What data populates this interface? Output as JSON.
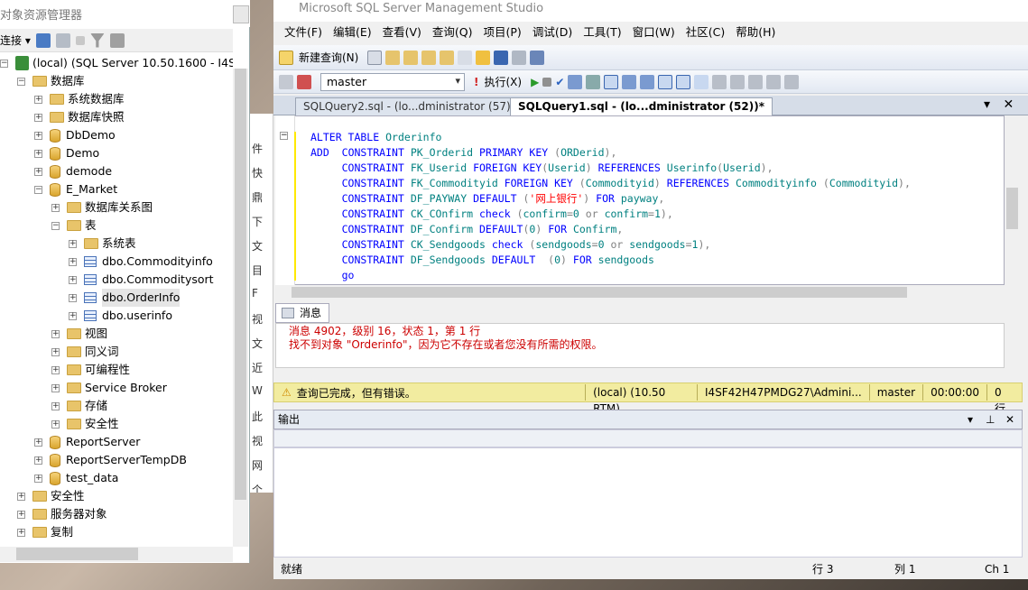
{
  "object_explorer": {
    "title": "对象资源管理器",
    "connect_label": "连接",
    "tree": [
      {
        "label": "(local) (SQL Server 10.50.1600 - I4SF42",
        "level": 0,
        "icon": "server",
        "expand": "-"
      },
      {
        "label": "数据库",
        "level": 1,
        "icon": "folder",
        "expand": "-"
      },
      {
        "label": "系统数据库",
        "level": 2,
        "icon": "folder",
        "expand": "+"
      },
      {
        "label": "数据库快照",
        "level": 2,
        "icon": "folder",
        "expand": "+"
      },
      {
        "label": "DbDemo",
        "level": 2,
        "icon": "database",
        "expand": "+"
      },
      {
        "label": "Demo",
        "level": 2,
        "icon": "database",
        "expand": "+"
      },
      {
        "label": "demode",
        "level": 2,
        "icon": "database",
        "expand": "+"
      },
      {
        "label": "E_Market",
        "level": 2,
        "icon": "database",
        "expand": "-"
      },
      {
        "label": "数据库关系图",
        "level": 3,
        "icon": "folder",
        "expand": "+"
      },
      {
        "label": "表",
        "level": 3,
        "icon": "folder",
        "expand": "-"
      },
      {
        "label": "系统表",
        "level": 4,
        "icon": "folder",
        "expand": "+"
      },
      {
        "label": "dbo.Commodityinfo",
        "level": 4,
        "icon": "table",
        "expand": "+"
      },
      {
        "label": "dbo.Commoditysort",
        "level": 4,
        "icon": "table",
        "expand": "+"
      },
      {
        "label": "dbo.OrderInfo",
        "level": 4,
        "icon": "table",
        "expand": "+",
        "selected": true
      },
      {
        "label": "dbo.userinfo",
        "level": 4,
        "icon": "table",
        "expand": "+"
      },
      {
        "label": "视图",
        "level": 3,
        "icon": "folder",
        "expand": "+"
      },
      {
        "label": "同义词",
        "level": 3,
        "icon": "folder",
        "expand": "+"
      },
      {
        "label": "可编程性",
        "level": 3,
        "icon": "folder",
        "expand": "+"
      },
      {
        "label": "Service Broker",
        "level": 3,
        "icon": "folder",
        "expand": "+"
      },
      {
        "label": "存储",
        "level": 3,
        "icon": "folder",
        "expand": "+"
      },
      {
        "label": "安全性",
        "level": 3,
        "icon": "folder",
        "expand": "+"
      },
      {
        "label": "ReportServer",
        "level": 2,
        "icon": "database",
        "expand": "+"
      },
      {
        "label": "ReportServerTempDB",
        "level": 2,
        "icon": "database",
        "expand": "+"
      },
      {
        "label": "test_data",
        "level": 2,
        "icon": "database",
        "expand": "+"
      },
      {
        "label": "安全性",
        "level": 1,
        "icon": "folder",
        "expand": "+"
      },
      {
        "label": "服务器对象",
        "level": 1,
        "icon": "folder",
        "expand": "+"
      },
      {
        "label": "复制",
        "level": 1,
        "icon": "folder",
        "expand": "+"
      }
    ]
  },
  "middle_strip": [
    "件",
    "快",
    "鼎",
    "下",
    "文",
    "目",
    "F",
    "视",
    "文",
    "近",
    "W",
    "此",
    "视",
    "网",
    "个项"
  ],
  "ssms": {
    "title": "Microsoft SQL Server Management Studio",
    "menus": [
      "文件(F)",
      "编辑(E)",
      "查看(V)",
      "查询(Q)",
      "项目(P)",
      "调试(D)",
      "工具(T)",
      "窗口(W)",
      "社区(C)",
      "帮助(H)"
    ],
    "new_query_label": "新建查询(N)",
    "database_selected": "master",
    "execute_label": "执行(X)",
    "tabs": [
      "SQLQuery2.sql - (lo...dministrator (57))*",
      "SQLQuery1.sql - (lo...dministrator (52))*"
    ],
    "messages_tab": "消息",
    "messages": [
      "消息 4902，级别 16，状态 1，第 1 行",
      "找不到对象 \"Orderinfo\"，因为它不存在或者您没有所需的权限。"
    ],
    "status": {
      "text": "查询已完成，但有错误。",
      "server": "(local) (10.50 RTM)",
      "user": "I4SF42H47PMDG27\\Admini...",
      "database": "master",
      "time": "00:00:00",
      "rows": "0 行"
    },
    "output_title": "输出",
    "bottom": {
      "ready": "就绪",
      "line": "行 3",
      "col": "列 1",
      "ch": "Ch 1"
    }
  }
}
